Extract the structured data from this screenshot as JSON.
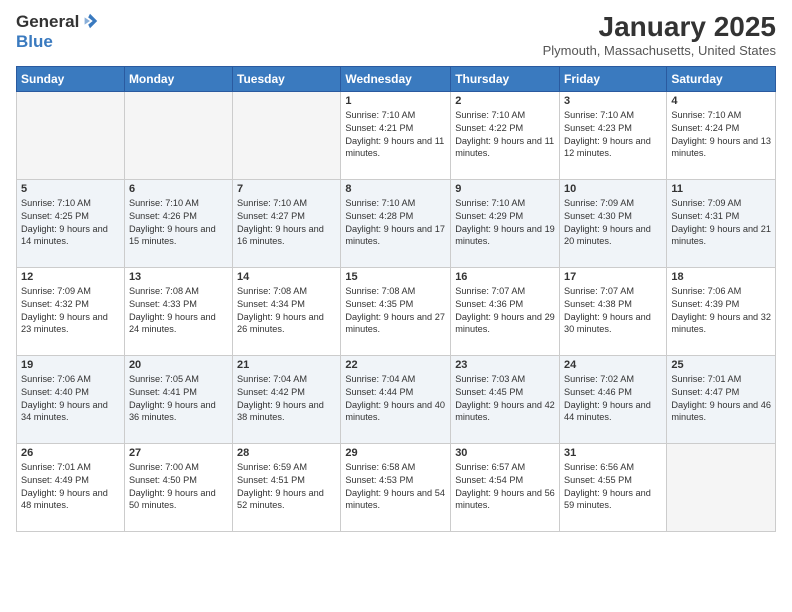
{
  "header": {
    "logo_general": "General",
    "logo_blue": "Blue",
    "month_title": "January 2025",
    "location": "Plymouth, Massachusetts, United States"
  },
  "days_of_week": [
    "Sunday",
    "Monday",
    "Tuesday",
    "Wednesday",
    "Thursday",
    "Friday",
    "Saturday"
  ],
  "weeks": [
    [
      {
        "day": "",
        "empty": true
      },
      {
        "day": "",
        "empty": true
      },
      {
        "day": "",
        "empty": true
      },
      {
        "day": "1",
        "sunrise": "7:10 AM",
        "sunset": "4:21 PM",
        "daylight": "9 hours and 11 minutes."
      },
      {
        "day": "2",
        "sunrise": "7:10 AM",
        "sunset": "4:22 PM",
        "daylight": "9 hours and 11 minutes."
      },
      {
        "day": "3",
        "sunrise": "7:10 AM",
        "sunset": "4:23 PM",
        "daylight": "9 hours and 12 minutes."
      },
      {
        "day": "4",
        "sunrise": "7:10 AM",
        "sunset": "4:24 PM",
        "daylight": "9 hours and 13 minutes."
      }
    ],
    [
      {
        "day": "5",
        "sunrise": "7:10 AM",
        "sunset": "4:25 PM",
        "daylight": "9 hours and 14 minutes."
      },
      {
        "day": "6",
        "sunrise": "7:10 AM",
        "sunset": "4:26 PM",
        "daylight": "9 hours and 15 minutes."
      },
      {
        "day": "7",
        "sunrise": "7:10 AM",
        "sunset": "4:27 PM",
        "daylight": "9 hours and 16 minutes."
      },
      {
        "day": "8",
        "sunrise": "7:10 AM",
        "sunset": "4:28 PM",
        "daylight": "9 hours and 17 minutes."
      },
      {
        "day": "9",
        "sunrise": "7:10 AM",
        "sunset": "4:29 PM",
        "daylight": "9 hours and 19 minutes."
      },
      {
        "day": "10",
        "sunrise": "7:09 AM",
        "sunset": "4:30 PM",
        "daylight": "9 hours and 20 minutes."
      },
      {
        "day": "11",
        "sunrise": "7:09 AM",
        "sunset": "4:31 PM",
        "daylight": "9 hours and 21 minutes."
      }
    ],
    [
      {
        "day": "12",
        "sunrise": "7:09 AM",
        "sunset": "4:32 PM",
        "daylight": "9 hours and 23 minutes."
      },
      {
        "day": "13",
        "sunrise": "7:08 AM",
        "sunset": "4:33 PM",
        "daylight": "9 hours and 24 minutes."
      },
      {
        "day": "14",
        "sunrise": "7:08 AM",
        "sunset": "4:34 PM",
        "daylight": "9 hours and 26 minutes."
      },
      {
        "day": "15",
        "sunrise": "7:08 AM",
        "sunset": "4:35 PM",
        "daylight": "9 hours and 27 minutes."
      },
      {
        "day": "16",
        "sunrise": "7:07 AM",
        "sunset": "4:36 PM",
        "daylight": "9 hours and 29 minutes."
      },
      {
        "day": "17",
        "sunrise": "7:07 AM",
        "sunset": "4:38 PM",
        "daylight": "9 hours and 30 minutes."
      },
      {
        "day": "18",
        "sunrise": "7:06 AM",
        "sunset": "4:39 PM",
        "daylight": "9 hours and 32 minutes."
      }
    ],
    [
      {
        "day": "19",
        "sunrise": "7:06 AM",
        "sunset": "4:40 PM",
        "daylight": "9 hours and 34 minutes."
      },
      {
        "day": "20",
        "sunrise": "7:05 AM",
        "sunset": "4:41 PM",
        "daylight": "9 hours and 36 minutes."
      },
      {
        "day": "21",
        "sunrise": "7:04 AM",
        "sunset": "4:42 PM",
        "daylight": "9 hours and 38 minutes."
      },
      {
        "day": "22",
        "sunrise": "7:04 AM",
        "sunset": "4:44 PM",
        "daylight": "9 hours and 40 minutes."
      },
      {
        "day": "23",
        "sunrise": "7:03 AM",
        "sunset": "4:45 PM",
        "daylight": "9 hours and 42 minutes."
      },
      {
        "day": "24",
        "sunrise": "7:02 AM",
        "sunset": "4:46 PM",
        "daylight": "9 hours and 44 minutes."
      },
      {
        "day": "25",
        "sunrise": "7:01 AM",
        "sunset": "4:47 PM",
        "daylight": "9 hours and 46 minutes."
      }
    ],
    [
      {
        "day": "26",
        "sunrise": "7:01 AM",
        "sunset": "4:49 PM",
        "daylight": "9 hours and 48 minutes."
      },
      {
        "day": "27",
        "sunrise": "7:00 AM",
        "sunset": "4:50 PM",
        "daylight": "9 hours and 50 minutes."
      },
      {
        "day": "28",
        "sunrise": "6:59 AM",
        "sunset": "4:51 PM",
        "daylight": "9 hours and 52 minutes."
      },
      {
        "day": "29",
        "sunrise": "6:58 AM",
        "sunset": "4:53 PM",
        "daylight": "9 hours and 54 minutes."
      },
      {
        "day": "30",
        "sunrise": "6:57 AM",
        "sunset": "4:54 PM",
        "daylight": "9 hours and 56 minutes."
      },
      {
        "day": "31",
        "sunrise": "6:56 AM",
        "sunset": "4:55 PM",
        "daylight": "9 hours and 59 minutes."
      },
      {
        "day": "",
        "empty": true
      }
    ]
  ],
  "labels": {
    "sunrise": "Sunrise:",
    "sunset": "Sunset:",
    "daylight": "Daylight:"
  }
}
